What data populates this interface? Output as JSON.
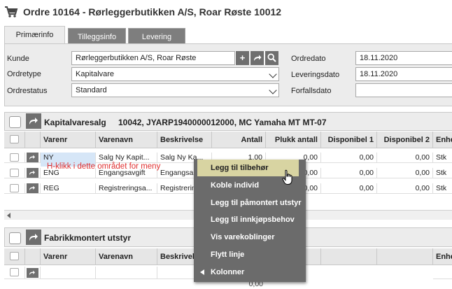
{
  "window": {
    "title": "Ordre 10164 - Rørleggerbutikken A/S, Roar Røste 10012"
  },
  "tabs": [
    {
      "label": "Primærinfo",
      "active": true
    },
    {
      "label": "Tilleggsinfo",
      "active": false
    },
    {
      "label": "Levering",
      "active": false
    }
  ],
  "form": {
    "kunde_label": "Kunde",
    "kunde_value": "Rørleggerbutikken A/S, Roar Røste",
    "ordretype_label": "Ordretype",
    "ordretype_value": "Kapitalvare",
    "ordrestatus_label": "Ordrestatus",
    "ordrestatus_value": "Standard",
    "ordredato_label": "Ordredato",
    "ordredato_value": "18.11.2020",
    "leveringsdato_label": "Leveringsdato",
    "leveringsdato_value": "18.11.2020",
    "forfallsdato_label": "Forfallsdato",
    "forfallsdato_value": "",
    "add_symbol": "+",
    "goto_symbol": "➦"
  },
  "section1": {
    "title": "Kapitalvaresalg",
    "subtitle": "10042, JYARP1940000012000, MC Yamaha MT MT-07"
  },
  "grid1": {
    "columns": [
      "Varenr",
      "Varenavn",
      "Beskrivelse",
      "Antall",
      "Plukk antall",
      "Disponibel 1",
      "Disponibel 2",
      "Enhet"
    ],
    "rows": [
      [
        "NY",
        "Salg Ny Kapit...",
        "Salg Ny Ka...",
        "1,00",
        "0,00",
        "0,00",
        "0,00",
        "Stk"
      ],
      [
        "ENG",
        "Engangsavgift",
        "Engangsa...",
        "",
        "0,00",
        "0,00",
        "0,00",
        "Stk"
      ],
      [
        "REG",
        "Registreringsa...",
        "Registrerin...",
        "",
        "0,00",
        "0,00",
        "0,00",
        "Stk"
      ]
    ]
  },
  "annotation": "H-klikk i dette området for meny",
  "section2": {
    "title": "Fabrikkmontert utstyr"
  },
  "grid2": {
    "columns": [
      "Varenr",
      "Varenavn",
      "Beskrivelse",
      "",
      "",
      "",
      "",
      "Enhet"
    ],
    "footer_value": "0,00"
  },
  "context_menu": {
    "items": [
      {
        "label": "Legg til tilbehør",
        "highlighted": true
      },
      {
        "label": "Koble individ"
      },
      {
        "label": "Legg til påmontert utstyr"
      },
      {
        "label": "Legg til innkjøpsbehov"
      },
      {
        "label": "Vis varekoblinger"
      },
      {
        "label": "Flytt linje"
      },
      {
        "label": "Kolonner",
        "submenu": true
      }
    ]
  },
  "colors": {
    "accent_gray": "#6f6f6f",
    "menu_bg": "#6b6b6b",
    "menu_highlight": "#d8d4a2",
    "annotation_red": "#e03030",
    "selected_cell": "#d6e6f7"
  }
}
